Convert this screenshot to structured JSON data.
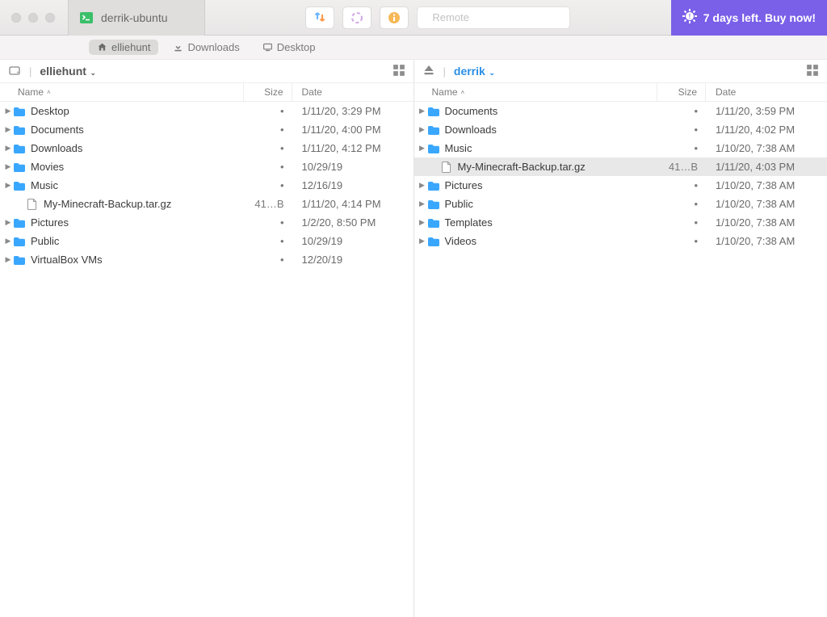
{
  "titlebar": {
    "tab_label": "derrik-ubuntu",
    "search_placeholder": "Remote",
    "promo_text": "7 days left. Buy now!"
  },
  "breadcrumbs": [
    {
      "label": "elliehunt",
      "icon": "home",
      "active": true
    },
    {
      "label": "Downloads",
      "icon": "download",
      "active": false
    },
    {
      "label": "Desktop",
      "icon": "desktop",
      "active": false
    }
  ],
  "columns": {
    "name": "Name",
    "size": "Size",
    "date": "Date"
  },
  "panes": {
    "left": {
      "title": "elliehunt",
      "items": [
        {
          "name": "Desktop",
          "type": "folder",
          "badge": "desktop",
          "size": "•",
          "date": "1/11/20, 3:29 PM"
        },
        {
          "name": "Documents",
          "type": "folder",
          "badge": "docs",
          "size": "•",
          "date": "1/11/20, 4:00 PM"
        },
        {
          "name": "Downloads",
          "type": "folder",
          "badge": "download",
          "size": "•",
          "date": "1/11/20, 4:12 PM"
        },
        {
          "name": "Movies",
          "type": "folder",
          "badge": "plain",
          "size": "•",
          "date": "10/29/19"
        },
        {
          "name": "Music",
          "type": "folder",
          "badge": "plain",
          "size": "•",
          "date": "12/16/19"
        },
        {
          "name": "My-Minecraft-Backup.tar.gz",
          "type": "file",
          "indent": true,
          "size": "41…B",
          "date": "1/11/20, 4:14 PM"
        },
        {
          "name": "Pictures",
          "type": "folder",
          "badge": "plain",
          "size": "•",
          "date": "1/2/20, 8:50 PM"
        },
        {
          "name": "Public",
          "type": "folder",
          "badge": "public",
          "size": "•",
          "date": "10/29/19"
        },
        {
          "name": "VirtualBox VMs",
          "type": "folder",
          "badge": "plain",
          "size": "•",
          "date": "12/20/19"
        }
      ]
    },
    "right": {
      "title": "derrik",
      "items": [
        {
          "name": "Documents",
          "type": "folder",
          "size": "•",
          "date": "1/11/20, 3:59 PM"
        },
        {
          "name": "Downloads",
          "type": "folder",
          "size": "•",
          "date": "1/11/20, 4:02 PM"
        },
        {
          "name": "Music",
          "type": "folder",
          "size": "•",
          "date": "1/10/20, 7:38 AM"
        },
        {
          "name": "My-Minecraft-Backup.tar.gz",
          "type": "file",
          "indent": true,
          "selected": true,
          "size": "41…B",
          "date": "1/11/20, 4:03 PM"
        },
        {
          "name": "Pictures",
          "type": "folder",
          "size": "•",
          "date": "1/10/20, 7:38 AM"
        },
        {
          "name": "Public",
          "type": "folder",
          "size": "•",
          "date": "1/10/20, 7:38 AM"
        },
        {
          "name": "Templates",
          "type": "folder",
          "size": "•",
          "date": "1/10/20, 7:38 AM"
        },
        {
          "name": "Videos",
          "type": "folder",
          "size": "•",
          "date": "1/10/20, 7:38 AM"
        }
      ]
    }
  }
}
